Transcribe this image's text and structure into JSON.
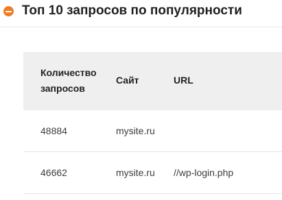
{
  "section": {
    "title": "Топ 10 запросов по популярности",
    "icon": "collapse-minus-icon",
    "accent_color": "#f07d24"
  },
  "table": {
    "headers": {
      "count": "Количество запросов",
      "site": "Сайт",
      "url": "URL"
    },
    "rows": [
      {
        "count": "48884",
        "site": "mysite.ru",
        "url": ""
      },
      {
        "count": "46662",
        "site": "mysite.ru",
        "url": "//wp-login.php"
      }
    ]
  }
}
